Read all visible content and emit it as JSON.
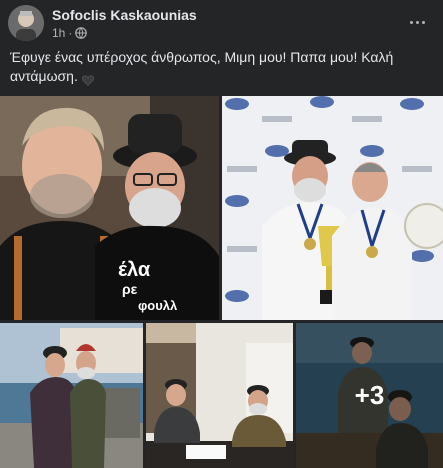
{
  "post": {
    "author": "Sofoclis Kaskaounias",
    "time": "1h",
    "privacy_icon": "globe-icon",
    "more_icon": "more-options-icon",
    "text": "Έφυγε  ένας υπέροχος άνθρωπος, Μιμη μου! Παπα μου! Καλή αντάμωση.",
    "heart_icon": "black-heart-icon"
  },
  "photos": {
    "tiles": [
      {
        "id": "photo-1",
        "shirt_text_line1": "έλα",
        "shirt_text_line2": "ρε",
        "shirt_text_line3": "φουλλ"
      },
      {
        "id": "photo-2"
      },
      {
        "id": "photo-3"
      },
      {
        "id": "photo-4"
      },
      {
        "id": "photo-5",
        "overlay": "+3"
      }
    ]
  },
  "colors": {
    "background": "#242526",
    "primary_text": "#e4e6eb",
    "secondary_text": "#b0b3b8"
  }
}
